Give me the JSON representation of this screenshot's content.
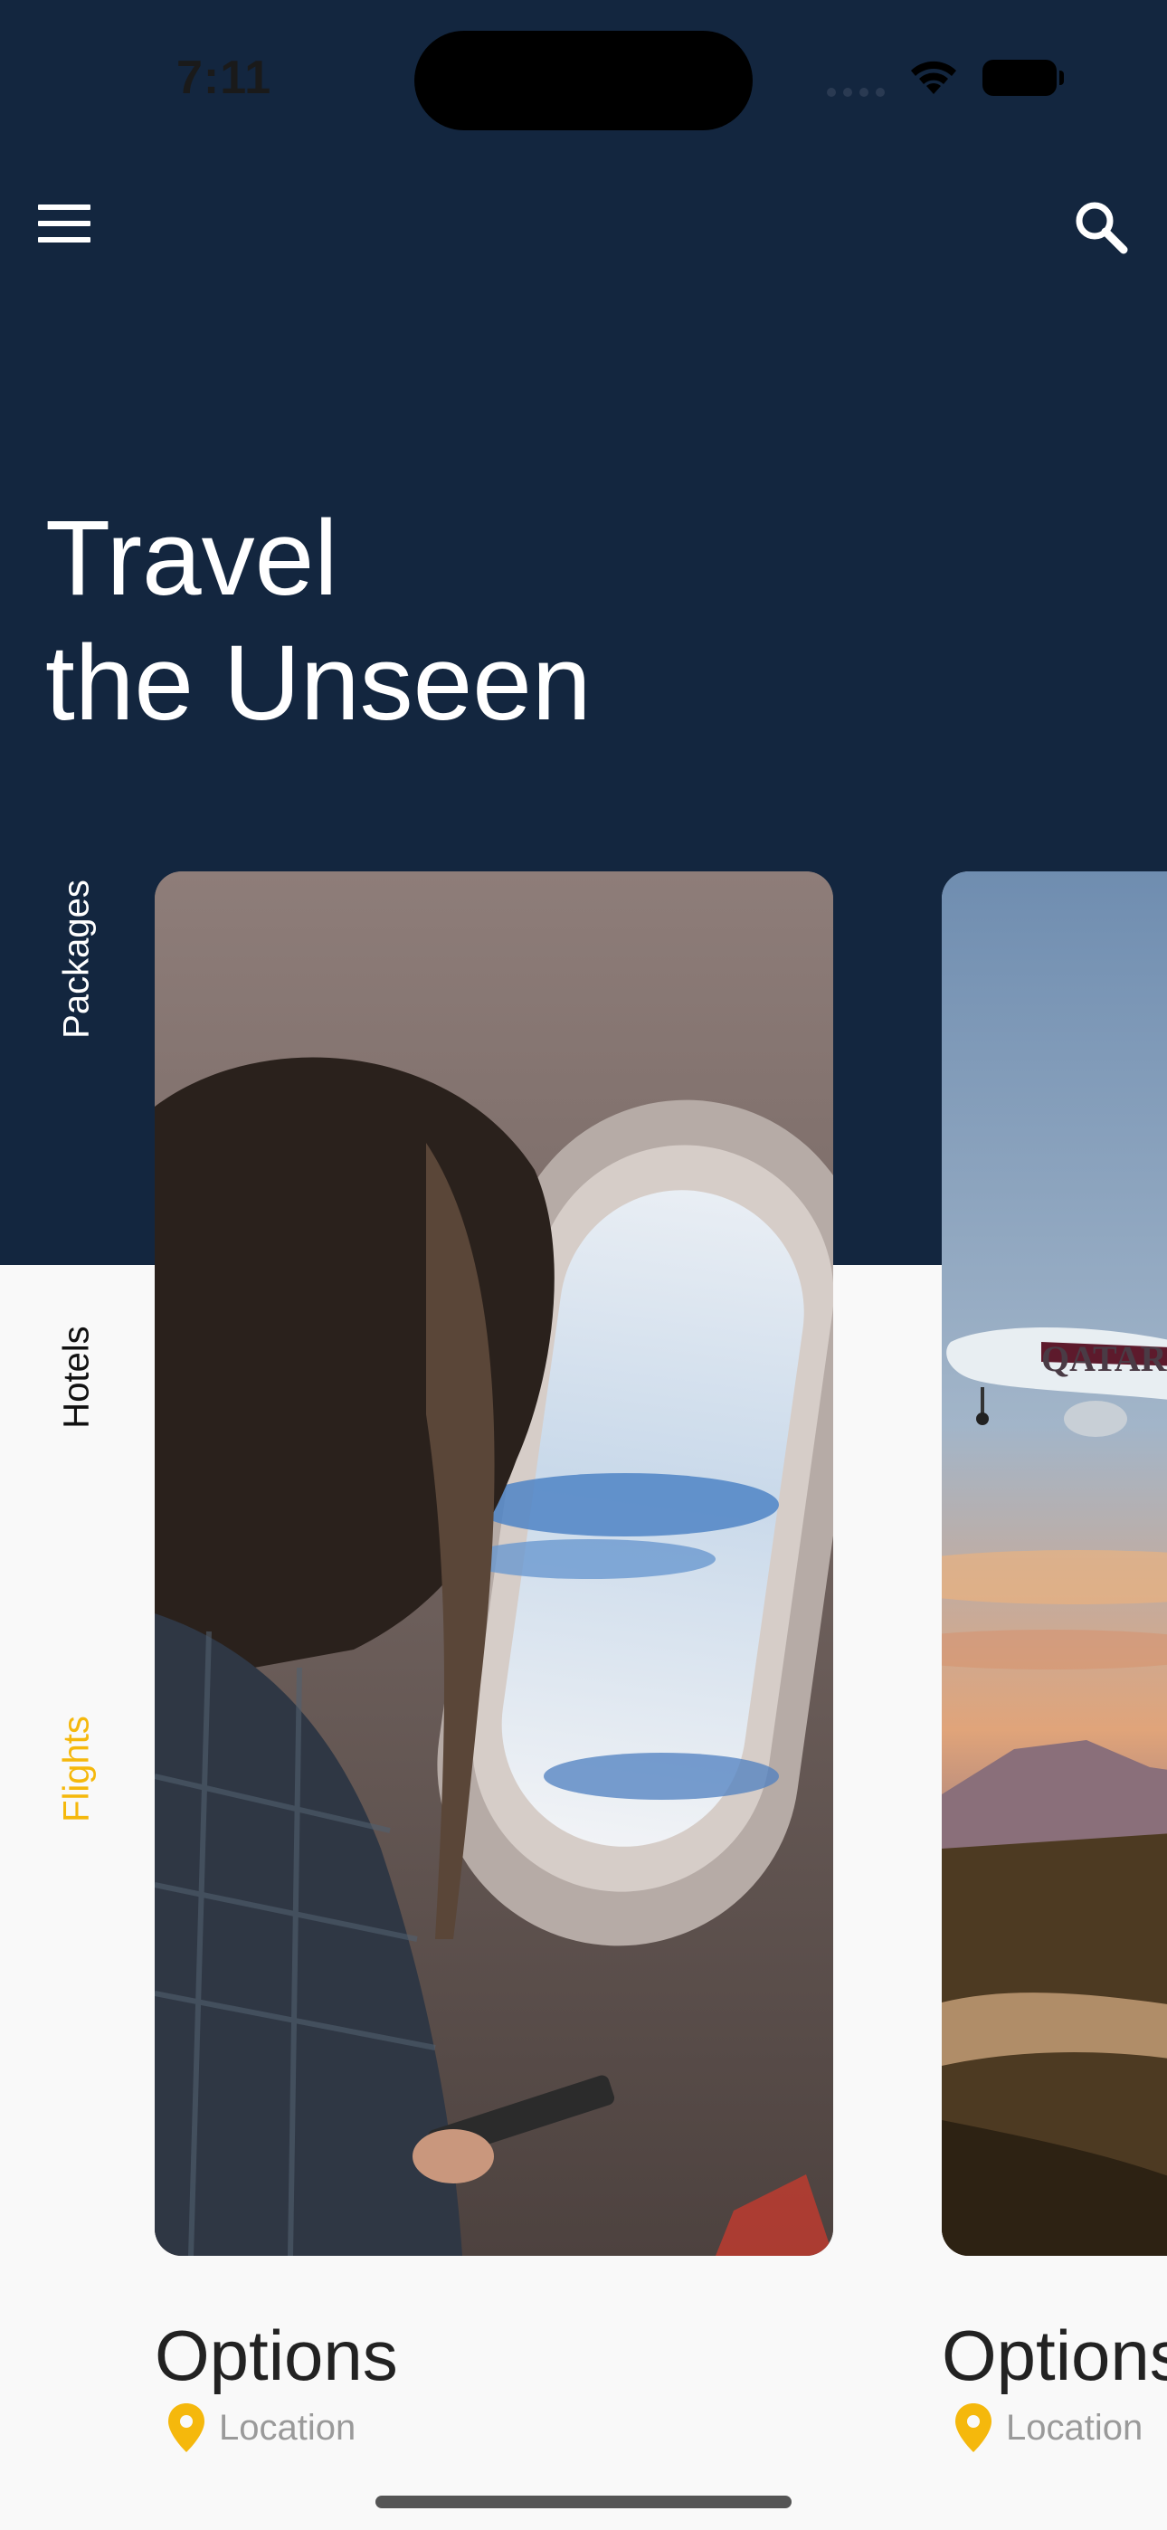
{
  "status_bar": {
    "time": "7:11"
  },
  "header": {
    "menu_icon": "menu-icon",
    "search_icon": "search-icon"
  },
  "hero": {
    "line1": "Travel",
    "line2": "the Unseen"
  },
  "side_tabs": [
    {
      "label": "Packages",
      "active": false
    },
    {
      "label": "Hotels",
      "active": false
    },
    {
      "label": "Flights",
      "active": true
    }
  ],
  "cards": [
    {
      "title": "Options",
      "location": "Location",
      "image": "woman-at-airplane-window-photo"
    },
    {
      "title": "Options",
      "location": "Location",
      "image": "qatar-airplane-sunset-photo"
    }
  ],
  "colors": {
    "header_bg": "#13263f",
    "accent": "#f5b80c",
    "page_bg": "#f9f9f9"
  }
}
